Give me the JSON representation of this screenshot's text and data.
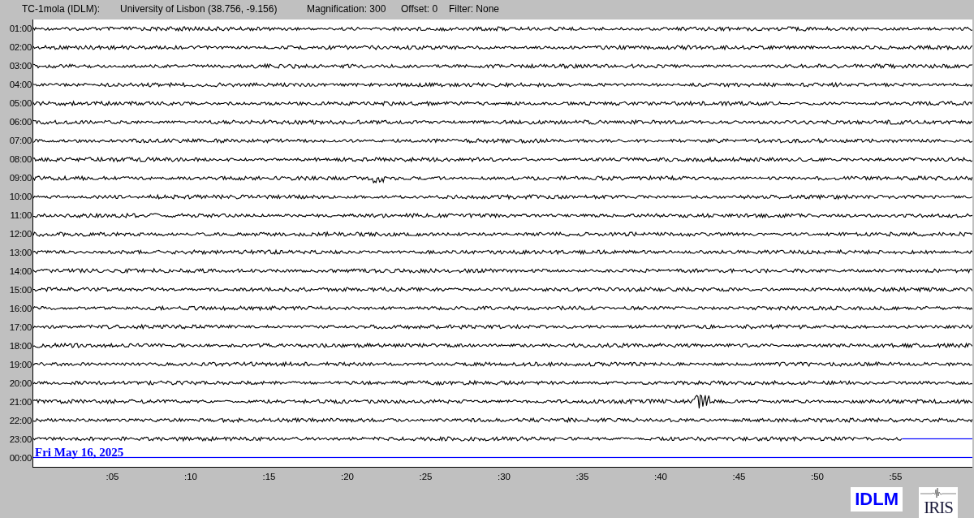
{
  "header": {
    "station": "TC-1mola (IDLM):",
    "location": "University of Lisbon (38.756, -9.156)",
    "magnification": "Magnification: 300",
    "offset": "Offset: 0",
    "filter": "Filter: None"
  },
  "rows": [
    {
      "label": "01:00",
      "kind": "full"
    },
    {
      "label": "02:00",
      "kind": "full"
    },
    {
      "label": "03:00",
      "kind": "full"
    },
    {
      "label": "04:00",
      "kind": "full"
    },
    {
      "label": "05:00",
      "kind": "full"
    },
    {
      "label": "06:00",
      "kind": "full"
    },
    {
      "label": "07:00",
      "kind": "full"
    },
    {
      "label": "08:00",
      "kind": "full"
    },
    {
      "label": "09:00",
      "kind": "full"
    },
    {
      "label": "10:00",
      "kind": "full"
    },
    {
      "label": "11:00",
      "kind": "full"
    },
    {
      "label": "12:00",
      "kind": "full"
    },
    {
      "label": "13:00",
      "kind": "full"
    },
    {
      "label": "14:00",
      "kind": "full"
    },
    {
      "label": "15:00",
      "kind": "full"
    },
    {
      "label": "16:00",
      "kind": "full"
    },
    {
      "label": "17:00",
      "kind": "full"
    },
    {
      "label": "18:00",
      "kind": "full"
    },
    {
      "label": "19:00",
      "kind": "full"
    },
    {
      "label": "20:00",
      "kind": "full"
    },
    {
      "label": "21:00",
      "kind": "full"
    },
    {
      "label": "22:00",
      "kind": "full"
    },
    {
      "label": "23:00",
      "kind": "partial",
      "level": 0.925
    },
    {
      "label": "00:00",
      "kind": "empty"
    }
  ],
  "date": "Fri May 16, 2025",
  "x_ticks": [
    ":05",
    ":10",
    ":15",
    ":20",
    ":25",
    ":30",
    ":35",
    ":40",
    ":45",
    ":50",
    ":55"
  ],
  "logos": {
    "network": "IDLM",
    "org": "IRIS"
  }
}
